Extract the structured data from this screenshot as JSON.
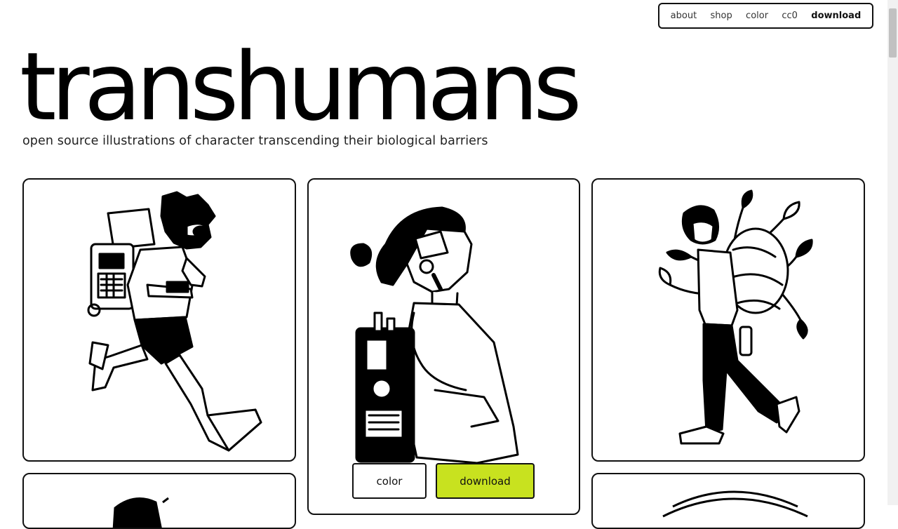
{
  "nav": {
    "items": [
      {
        "label": "about"
      },
      {
        "label": "shop"
      },
      {
        "label": "color"
      },
      {
        "label": "cc0"
      },
      {
        "label": "download"
      }
    ]
  },
  "hero": {
    "title": "transhumans",
    "subtitle": "open source illustrations of character transcending their biological barriers"
  },
  "card_actions": {
    "color_label": "color",
    "download_label": "download",
    "accent_color": "#c8e21f"
  }
}
